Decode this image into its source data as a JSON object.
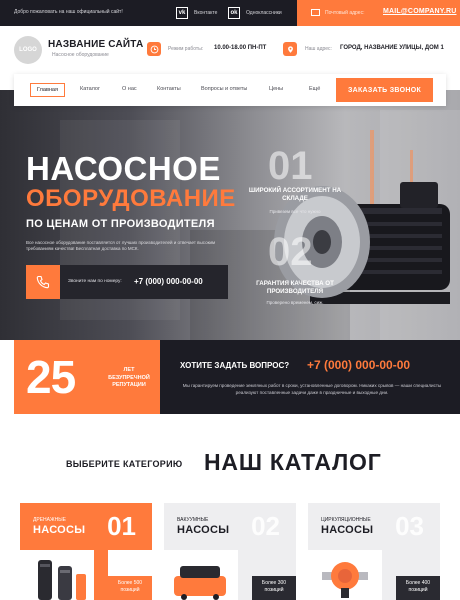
{
  "topbar": {
    "welcome": "Добро пожаловать на наш официальный сайт!",
    "social_vk_label": "Вконтакте",
    "social_ok_label": "Одноклассники",
    "mail_label": "Почтовый адрес:",
    "mail_address": "MAIL@COMPANY.RU"
  },
  "header": {
    "logo_text": "LOGO",
    "site_name": "НАЗВАНИЕ САЙТА",
    "site_sub": "Насосное оборудование",
    "hours_label": "Режим работы:",
    "hours_value": "10.00-18.00 ПН-ПТ",
    "address_label": "Наш адрес:",
    "address_value": "ГОРОД, НАЗВАНИЕ УЛИЦЫ, ДОМ 1"
  },
  "nav": {
    "items": [
      "Главная",
      "Каталог",
      "О нас",
      "Контакты",
      "Вопросы и ответы",
      "Цены",
      "Ещё"
    ],
    "cta": "ЗАКАЗАТЬ ЗВОНОК"
  },
  "hero": {
    "line1": "НАСОСНОЕ",
    "line2": "ОБОРУДОВАНИЕ",
    "line3": "ПО ЦЕНАМ ОТ ПРОИЗВОДИТЕЛЯ",
    "description": "Все насосное оборудование поставляется от лучших производителей и отвечает высоким требованиям качества! Бесплатная доставка по МСК.",
    "phone_label": "Звоните нам по номеру:",
    "phone": "+7 (000) 000-00-00",
    "features": [
      {
        "num": "01",
        "title": "ШИРОКИЙ АССОРТИМЕНТ НА СКЛАДЕ",
        "sub": "Привезем все что нужно"
      },
      {
        "num": "02",
        "title": "ГАРАНТИЯ КАЧЕСТВА ОТ ПРОИЗВОДИТЕЛЯ",
        "sub": "Проверено временем, сиж."
      }
    ]
  },
  "stats": {
    "years": "25",
    "years_label": "ЛЕТ БЕЗУПРЕЧНОЙ РЕПУТАЦИИ",
    "question": "ХОТИТЕ ЗАДАТЬ ВОПРОС?",
    "phone": "+7 (000) 000-00-00",
    "text": "Мы гарантируем проведение земляных работ в сроки, установленные договором. Никаких срывов — наши специалисты реализуют поставленные задачи даже в праздничные и выходные дни."
  },
  "catalog": {
    "select_label": "ВЫБЕРИТЕ КАТЕГОРИЮ",
    "title": "НАШ КАТАЛОГ",
    "cards": [
      {
        "small": "ДРЕНАЖНЫЕ",
        "big": "НАСОСЫ",
        "num": "01",
        "more": "Более 500 позиций"
      },
      {
        "small": "ВАКУУМНЫЕ",
        "big": "НАСОСЫ",
        "num": "02",
        "more": "Более 300 позиций"
      },
      {
        "small": "ЦИРКУЛЯЦИОННЫЕ",
        "big": "НАСОСЫ",
        "num": "03",
        "more": "Более 400 позиций"
      }
    ]
  },
  "colors": {
    "accent": "#ff7a3c",
    "dark": "#1c1c24",
    "light_gray": "#eeeef0"
  }
}
